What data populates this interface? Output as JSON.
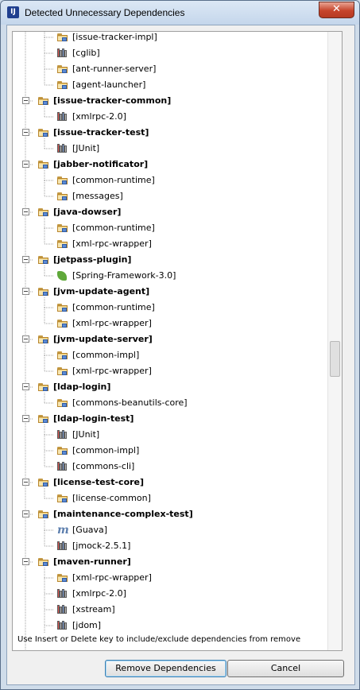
{
  "window": {
    "title": "Detected Unnecessary Dependencies",
    "close_glyph": "✕",
    "app_icon": "IJ"
  },
  "tree": {
    "items": [
      {
        "label": "[issue-tracker-impl]",
        "level": 1,
        "icon": "folder-module"
      },
      {
        "label": "[cglib]",
        "level": 1,
        "icon": "library"
      },
      {
        "label": "[ant-runner-server]",
        "level": 1,
        "icon": "folder-module"
      },
      {
        "label": "[agent-launcher]",
        "level": 1,
        "icon": "folder-module"
      },
      {
        "label": "[issue-tracker-common]",
        "level": 0,
        "icon": "folder-module"
      },
      {
        "label": "[xmlrpc-2.0]",
        "level": 1,
        "icon": "library"
      },
      {
        "label": "[issue-tracker-test]",
        "level": 0,
        "icon": "folder-module"
      },
      {
        "label": "[JUnit]",
        "level": 1,
        "icon": "library"
      },
      {
        "label": "[jabber-notificator]",
        "level": 0,
        "icon": "folder-module"
      },
      {
        "label": "[common-runtime]",
        "level": 1,
        "icon": "folder-module"
      },
      {
        "label": "[messages]",
        "level": 1,
        "icon": "folder-module"
      },
      {
        "label": "[java-dowser]",
        "level": 0,
        "icon": "folder-module"
      },
      {
        "label": "[common-runtime]",
        "level": 1,
        "icon": "folder-module"
      },
      {
        "label": "[xml-rpc-wrapper]",
        "level": 1,
        "icon": "folder-module"
      },
      {
        "label": "[jetpass-plugin]",
        "level": 0,
        "icon": "folder-module"
      },
      {
        "label": "[Spring-Framework-3.0]",
        "level": 1,
        "icon": "spring"
      },
      {
        "label": "[jvm-update-agent]",
        "level": 0,
        "icon": "folder-module"
      },
      {
        "label": "[common-runtime]",
        "level": 1,
        "icon": "folder-module"
      },
      {
        "label": "[xml-rpc-wrapper]",
        "level": 1,
        "icon": "folder-module"
      },
      {
        "label": "[jvm-update-server]",
        "level": 0,
        "icon": "folder-module"
      },
      {
        "label": "[common-impl]",
        "level": 1,
        "icon": "folder-module"
      },
      {
        "label": "[xml-rpc-wrapper]",
        "level": 1,
        "icon": "folder-module"
      },
      {
        "label": "[ldap-login]",
        "level": 0,
        "icon": "folder-module"
      },
      {
        "label": "[commons-beanutils-core]",
        "level": 1,
        "icon": "folder-module"
      },
      {
        "label": "[ldap-login-test]",
        "level": 0,
        "icon": "folder-module"
      },
      {
        "label": "[JUnit]",
        "level": 1,
        "icon": "library"
      },
      {
        "label": "[common-impl]",
        "level": 1,
        "icon": "folder-module"
      },
      {
        "label": "[commons-cli]",
        "level": 1,
        "icon": "library"
      },
      {
        "label": "[license-test-core]",
        "level": 0,
        "icon": "folder-module"
      },
      {
        "label": "[license-common]",
        "level": 1,
        "icon": "folder-module"
      },
      {
        "label": "[maintenance-complex-test]",
        "level": 0,
        "icon": "folder-module"
      },
      {
        "label": "[Guava]",
        "level": 1,
        "icon": "maven"
      },
      {
        "label": "[jmock-2.5.1]",
        "level": 1,
        "icon": "library"
      },
      {
        "label": "[maven-runner]",
        "level": 0,
        "icon": "folder-module"
      },
      {
        "label": "[xml-rpc-wrapper]",
        "level": 1,
        "icon": "folder-module"
      },
      {
        "label": "[xmlrpc-2.0]",
        "level": 1,
        "icon": "library"
      },
      {
        "label": "[xstream]",
        "level": 1,
        "icon": "library"
      },
      {
        "label": "[jdom]",
        "level": 1,
        "icon": "library"
      }
    ]
  },
  "hint": "Use Insert or Delete key to include/exclude dependencies from remove",
  "buttons": {
    "remove": "Remove Dependencies",
    "cancel": "Cancel"
  },
  "maven_glyph": "m"
}
